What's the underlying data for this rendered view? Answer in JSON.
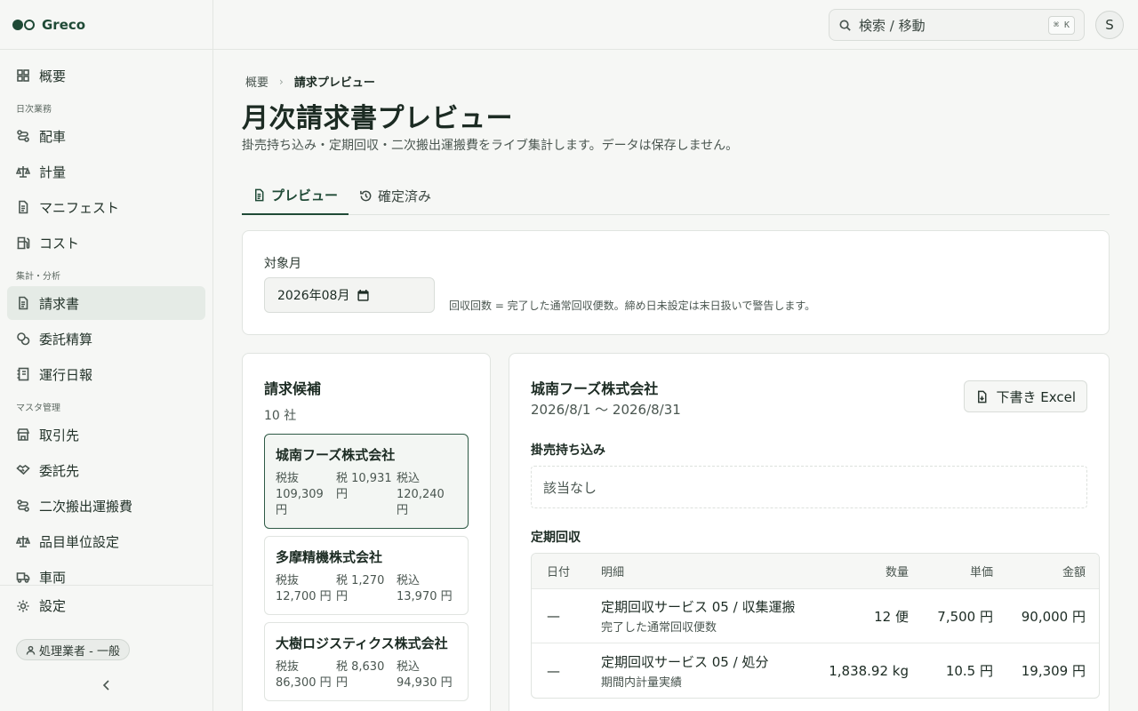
{
  "app": {
    "name": "Greco"
  },
  "sidebar": {
    "top_item": {
      "label": "概要",
      "icon": "dashboard-icon"
    },
    "sections": [
      {
        "label": "日次業務",
        "items": [
          {
            "label": "配車",
            "icon": "route-icon"
          },
          {
            "label": "計量",
            "icon": "scale-icon"
          },
          {
            "label": "マニフェスト",
            "icon": "document-icon"
          },
          {
            "label": "コスト",
            "icon": "fuel-icon"
          }
        ]
      },
      {
        "label": "集計・分析",
        "items": [
          {
            "label": "請求書",
            "icon": "invoice-icon",
            "active": true
          },
          {
            "label": "委託精算",
            "icon": "coins-icon"
          },
          {
            "label": "運行日報",
            "icon": "notebook-icon"
          }
        ]
      },
      {
        "label": "マスタ管理",
        "items": [
          {
            "label": "取引先",
            "icon": "store-icon"
          },
          {
            "label": "委託先",
            "icon": "handshake-icon"
          },
          {
            "label": "二次搬出運搬費",
            "icon": "route-icon"
          },
          {
            "label": "品目単位設定",
            "icon": "scale-icon"
          },
          {
            "label": "車両",
            "icon": "truck-icon"
          }
        ]
      }
    ],
    "settings_label": "設定",
    "role_badge": "処理業者 - 一般"
  },
  "topbar": {
    "search_placeholder": "検索 / 移動",
    "search_shortcut": "⌘ K",
    "avatar_initial": "S"
  },
  "breadcrumb": {
    "root": "概要",
    "current": "請求プレビュー"
  },
  "page": {
    "title": "月次請求書プレビュー",
    "subtitle": "掛売持ち込み・定期回収・二次搬出運搬費をライブ集計します。データは保存しません。"
  },
  "tabs": [
    {
      "label": "プレビュー",
      "icon": "document-icon",
      "active": true
    },
    {
      "label": "確定済み",
      "icon": "history-icon",
      "active": false
    }
  ],
  "month_picker": {
    "label": "対象月",
    "value": "2026年08月",
    "note": "回収回数 = 完了した通常回収便数。締め日未設定は末日扱いで警告します。"
  },
  "candidates": {
    "title": "請求候補",
    "count": "10 社",
    "items": [
      {
        "name": "城南フーズ株式会社",
        "excl": "税抜 109,309 円",
        "tax": "税 10,931 円",
        "incl": "税込 120,240 円",
        "selected": true
      },
      {
        "name": "多摩精機株式会社",
        "excl": "税抜 12,700 円",
        "tax": "税 1,270 円",
        "incl": "税込 13,970 円",
        "selected": false
      },
      {
        "name": "大樹ロジスティクス株式会社",
        "excl": "税抜 86,300 円",
        "tax": "税 8,630 円",
        "incl": "税込 94,930 円",
        "selected": false
      }
    ]
  },
  "detail": {
    "name": "城南フーズ株式会社",
    "period": "2026/8/1 〜 2026/8/31",
    "excel_button": "下書き Excel",
    "carry_in": {
      "title": "掛売持ち込み",
      "empty": "該当なし"
    },
    "regular": {
      "title": "定期回収",
      "headers": {
        "date": "日付",
        "desc": "明細",
        "qty": "数量",
        "unit": "単価",
        "amount": "金額"
      },
      "rows": [
        {
          "date": "—",
          "desc": "定期回収サービス 05 / 収集運搬",
          "sub": "完了した通常回収便数",
          "qty": "12 便",
          "unit": "7,500 円",
          "amount": "90,000 円"
        },
        {
          "date": "—",
          "desc": "定期回収サービス 05 / 処分",
          "sub": "期間内計量実績",
          "qty": "1,838.92 kg",
          "unit": "10.5 円",
          "amount": "19,309 円"
        }
      ]
    }
  }
}
